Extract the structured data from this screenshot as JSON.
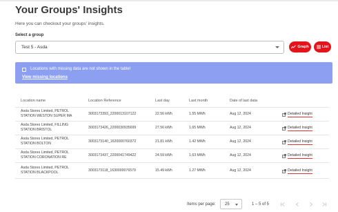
{
  "header": {
    "title": "Your Groups' Insights",
    "subtitle": "Here you can checkout your groups' insights.",
    "select_label": "Select a group"
  },
  "group_select": {
    "value": "Test 5 - Asda"
  },
  "view_buttons": {
    "graph": "Graph",
    "list": "List"
  },
  "banner": {
    "message": "Locations with missing data are not shown in the table!",
    "link": "View missing locations"
  },
  "table": {
    "headers": [
      "Location name",
      "Location Reference",
      "Last day",
      "Last month",
      "Date of last data"
    ],
    "action_label": "Detailed Insight",
    "rows": [
      {
        "name1": "Asda Stores Limited, PETROL",
        "name2": "STATION WESTON SUPER MA",
        "ref": "3003173393_2200013107122",
        "day": "22.56 kWh",
        "month": "1.55 MWh",
        "date": "Aug 12, 2024"
      },
      {
        "name1": "Asda Stores Limited, FILLING",
        "name2": "STATION BRISTOL",
        "ref": "3003173426_2200030935699",
        "day": "27.56 kWh",
        "month": "1.65 MWh",
        "date": "Aug 12, 2024"
      },
      {
        "name1": "Asda Stores Limited, PETROL",
        "name2": "STATION BOLTON",
        "ref": "3003173140_1620000760372",
        "day": "21.81 kWh",
        "month": "1.42 MWh",
        "date": "Aug 12, 2024"
      },
      {
        "name1": "Asda Stores Limited, PETROL",
        "name2": "STATION CORONATION RE",
        "ref": "3003173437_2200041749422",
        "day": "24.59 kWh",
        "month": "1.63 MWh",
        "date": "Aug 12, 2024"
      },
      {
        "name1": "Asda Stores Limited, PETROL",
        "name2": "STATION BLACKPOOL",
        "ref": "3003173118_1630000076579",
        "day": "15.49 kWh",
        "month": "1.27 MWh",
        "date": "Aug 12, 2024"
      }
    ]
  },
  "pagination": {
    "label": "Items per page:",
    "per_page": "25",
    "range": "1 – 5 of 5"
  },
  "colors": {
    "accent_red": "#e5141b",
    "banner_blue": "#8c9ff0",
    "title": "#3a3a3a"
  },
  "icons": [
    "graph-icon",
    "list-icon",
    "external-link-icon",
    "chevron-down-icon",
    "first-page-icon",
    "prev-page-icon",
    "next-page-icon",
    "last-page-icon"
  ]
}
